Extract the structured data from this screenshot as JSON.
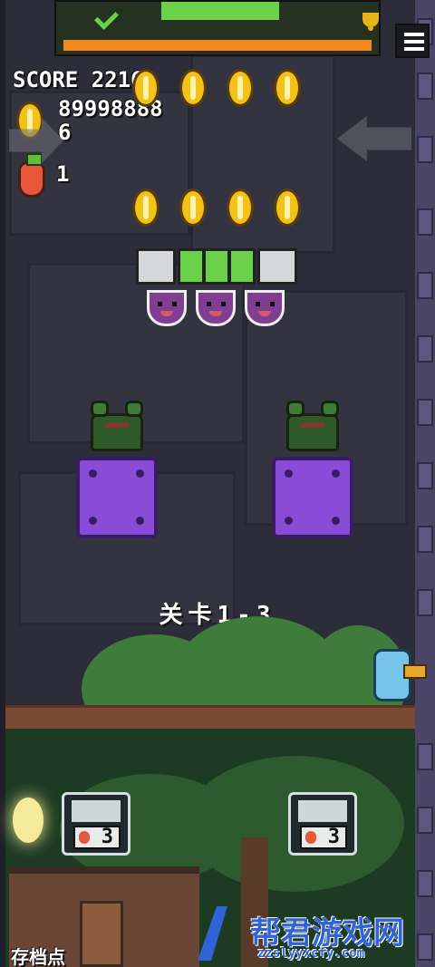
{
  "hud": {
    "score_label": "SCORE 2216",
    "coin_total": "89998888",
    "coins_collected": "6",
    "carrots": "1"
  },
  "level": {
    "label": "关卡1-3"
  },
  "checkpoint": {
    "label": "存档点",
    "save_slots": [
      "3",
      "3"
    ]
  },
  "watermark": {
    "title": "帮君游戏网",
    "url": "zzslyyxcfy.com"
  },
  "icons": {
    "menu": "hamburger-menu-icon",
    "trophy": "trophy-icon",
    "check": "check-icon",
    "coin": "coin-icon",
    "carrot": "carrot-icon"
  },
  "colors": {
    "coin": "#f2c21a",
    "progress": "#f08a1e",
    "purple_block": "#8a4bd6",
    "frog": "#2e5a2a"
  },
  "progress": {
    "fill": 1.0
  }
}
